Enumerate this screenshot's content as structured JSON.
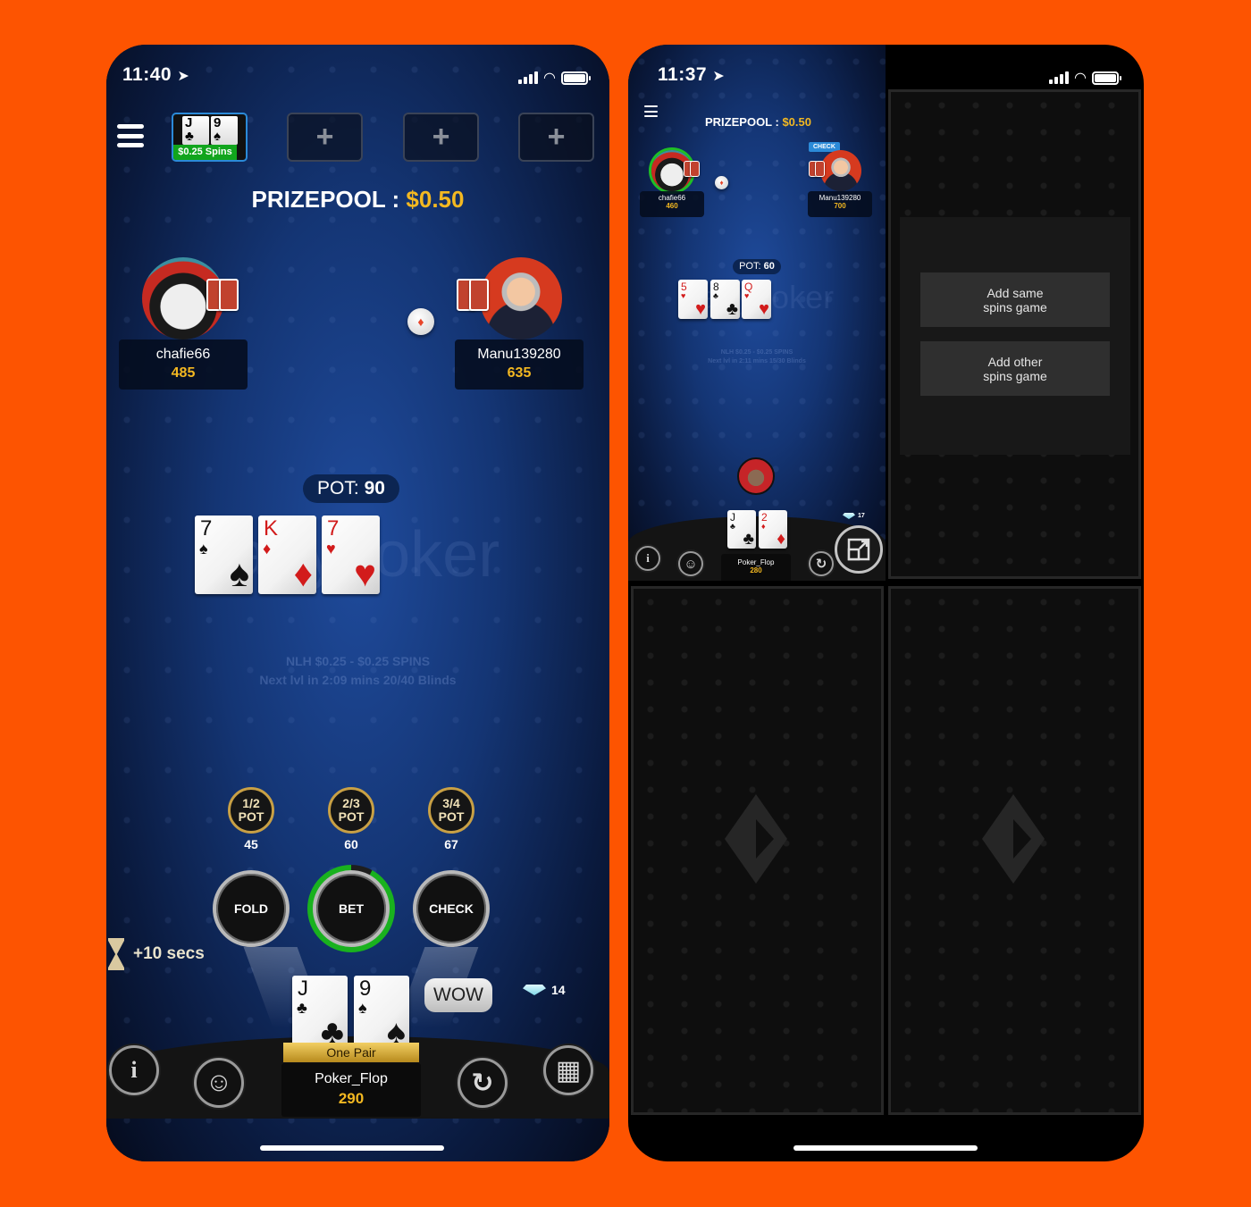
{
  "left_phone": {
    "status_bar": {
      "time": "11:40"
    },
    "table_tabs": {
      "active": {
        "cards": [
          {
            "rank": "J",
            "suit": "♣"
          },
          {
            "rank": "9",
            "suit": "♠"
          }
        ],
        "label": "$0.25 Spins"
      },
      "empty_slot_symbol": "+"
    },
    "prizepool": {
      "label": "PRIZEPOOL :",
      "amount": "$0.50"
    },
    "players": [
      {
        "name": "chafie66",
        "stack": "485",
        "avatar": "penguin"
      },
      {
        "name": "Manu139280",
        "stack": "635",
        "avatar": "grey-haired-man"
      }
    ],
    "pot": {
      "label": "POT:",
      "value": "90"
    },
    "board": [
      {
        "rank": "7",
        "suit": "♠",
        "color": "black"
      },
      {
        "rank": "K",
        "suit": "♦",
        "color": "red"
      },
      {
        "rank": "7",
        "suit": "♥",
        "color": "red"
      }
    ],
    "watermark": "partypoker",
    "table_info": {
      "line1": "NLH $0.25 - $0.25 SPINS",
      "line2": "Next lvl in 2:09 mins 20/40 Blinds"
    },
    "bet_presets": [
      {
        "fraction": "1/2",
        "label": "POT",
        "amount": "45"
      },
      {
        "fraction": "2/3",
        "label": "POT",
        "amount": "60"
      },
      {
        "fraction": "3/4",
        "label": "POT",
        "amount": "67"
      }
    ],
    "actions": {
      "fold": "FOLD",
      "bet": "BET",
      "check": "CHECK"
    },
    "action_timer_remaining": 0.92,
    "timebank": "+10 secs",
    "hero": {
      "cards": [
        {
          "rank": "J",
          "suit": "♣",
          "color": "black"
        },
        {
          "rank": "9",
          "suit": "♠",
          "color": "black"
        }
      ],
      "hand_label": "One Pair",
      "name": "Poker_Flop",
      "stack": "290"
    },
    "chat_bubble": "WOW",
    "diamonds": "14",
    "bottom_icons": {
      "info": "i",
      "emoji": "☺",
      "rebuy": "↻",
      "grid": "▦"
    }
  },
  "right_phone": {
    "status_bar": {
      "time": "11:37"
    },
    "prizepool": {
      "label": "PRIZEPOOL :",
      "amount": "$0.50"
    },
    "players": [
      {
        "name": "chafie66",
        "stack": "460",
        "avatar": "penguin"
      },
      {
        "name": "Manu139280",
        "stack": "700",
        "avatar": "grey-haired-man",
        "action_badge": "CHECK"
      }
    ],
    "pot": {
      "label": "POT:",
      "value": "60"
    },
    "board": [
      {
        "rank": "5",
        "suit": "♥",
        "color": "red"
      },
      {
        "rank": "8",
        "suit": "♣",
        "color": "black"
      },
      {
        "rank": "Q",
        "suit": "♥",
        "color": "red"
      }
    ],
    "watermark": "partypoker",
    "table_info": {
      "line1": "NLH $0.25 - $0.25 SPINS",
      "line2": "Next lvl in 2:11 mins 15/30 Blinds"
    },
    "hero": {
      "cards": [
        {
          "rank": "J",
          "suit": "♣",
          "color": "black"
        },
        {
          "rank": "2",
          "suit": "♦",
          "color": "red"
        }
      ],
      "name": "Poker_Flop",
      "stack": "280",
      "avatar": "goat"
    },
    "diamonds": "17",
    "add_menu": {
      "same": "Add same\nspins game",
      "other": "Add other\nspins game"
    }
  }
}
